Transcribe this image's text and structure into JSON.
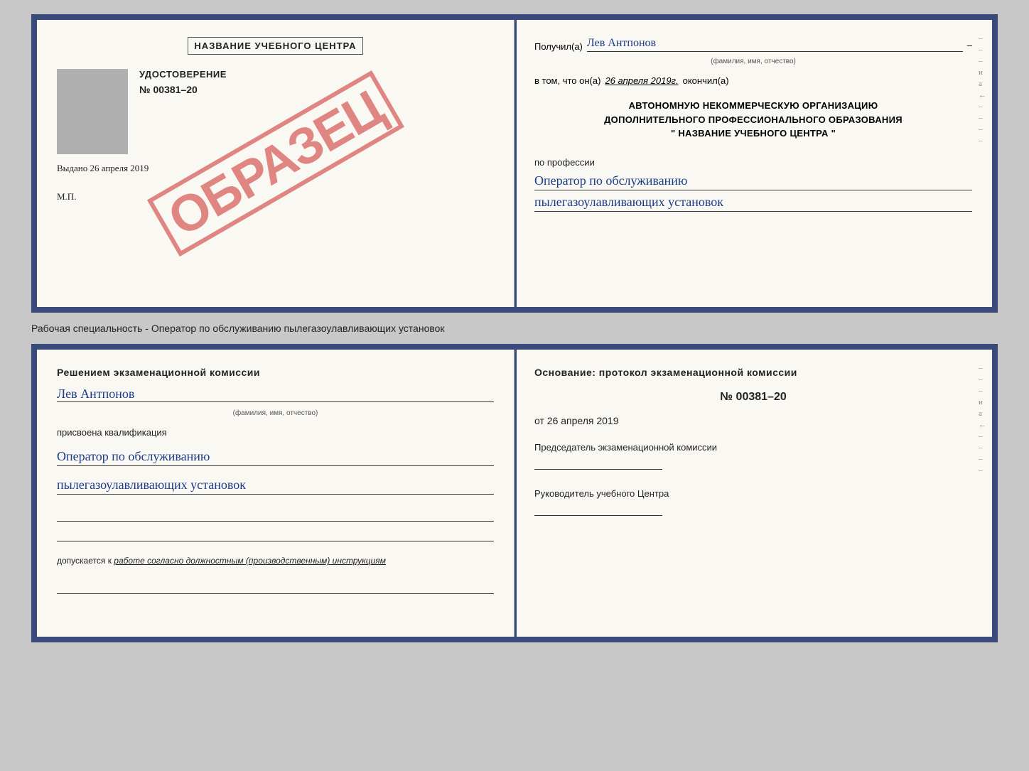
{
  "cert": {
    "left": {
      "title": "НАЗВАНИЕ УЧЕБНОГО ЦЕНТРА",
      "doc_type": "УДОСТОВЕРЕНИЕ",
      "doc_number": "№ 00381–20",
      "issued_label": "Выдано",
      "issued_date": "26 апреля 2019",
      "mp_label": "М.П.",
      "watermark": "ОБРАЗЕЦ"
    },
    "right": {
      "received_label": "Получил(а)",
      "recipient_name": "Лев Антпонов",
      "fio_subtitle": "(фамилия, имя, отчество)",
      "date_prefix": "в том, что он(а)",
      "date_value": "26 апреля 2019г.",
      "date_suffix": "окончил(а)",
      "org_line1": "АВТОНОМНУЮ НЕКОММЕРЧЕСКУЮ ОРГАНИЗАЦИЮ",
      "org_line2": "ДОПОЛНИТЕЛЬНОГО ПРОФЕССИОНАЛЬНОГО ОБРАЗОВАНИЯ",
      "org_line3": "\" НАЗВАНИЕ УЧЕБНОГО ЦЕНТРА \"",
      "profession_label": "по профессии",
      "profession_line1": "Оператор по обслуживанию",
      "profession_line2": "пылегазоулавливающих установок"
    }
  },
  "separator": {
    "text": "Рабочая специальность - Оператор по обслуживанию пылегазоулавливающих установок"
  },
  "qual": {
    "left": {
      "commission_title": "Решением экзаменационной комиссии",
      "person_name": "Лев Антпонов",
      "fio_subtitle": "(фамилия, имя, отчество)",
      "qualification_label": "присвоена квалификация",
      "qual_line1": "Оператор по обслуживанию",
      "qual_line2": "пылегазоулавливающих установок",
      "dopusk_label": "допускается к",
      "dopusk_value": "работе согласно должностным (производственным) инструкциям"
    },
    "right": {
      "osnovaniye_label": "Основание: протокол экзаменационной комиссии",
      "protocol_number": "№ 00381–20",
      "date_prefix": "от",
      "date_value": "26 апреля 2019",
      "chairman_title": "Председатель экзаменационной комиссии",
      "rukovoditel_title": "Руководитель учебного Центра"
    }
  },
  "side_marks": [
    "–",
    "–",
    "–",
    "и",
    "а",
    "←",
    "–",
    "–",
    "–",
    "–"
  ]
}
